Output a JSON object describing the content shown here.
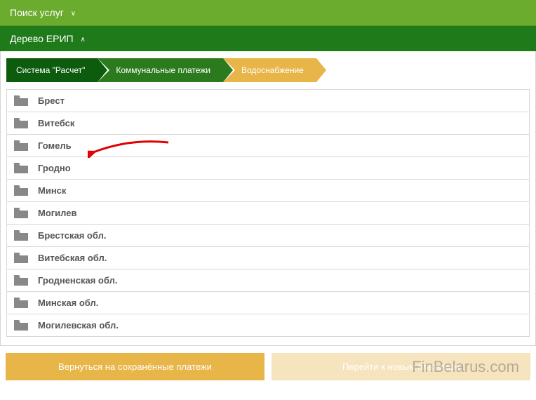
{
  "header": {
    "search_label": "Поиск услуг",
    "tree_label": "Дерево ЕРИП"
  },
  "breadcrumb": {
    "items": [
      {
        "label": "Система \"Расчет\""
      },
      {
        "label": "Коммунальные платежи"
      },
      {
        "label": "Водоснабжение"
      }
    ]
  },
  "folders": [
    {
      "label": "Брест"
    },
    {
      "label": "Витебск"
    },
    {
      "label": "Гомель"
    },
    {
      "label": "Гродно"
    },
    {
      "label": "Минск"
    },
    {
      "label": "Могилев"
    },
    {
      "label": "Брестская обл."
    },
    {
      "label": "Витебская обл."
    },
    {
      "label": "Гродненская обл."
    },
    {
      "label": "Минская обл."
    },
    {
      "label": "Могилевская обл."
    }
  ],
  "buttons": {
    "back_saved": "Вернуться на сохранённые платежи",
    "new_payments": "Перейти к новым платежам"
  },
  "watermark": "FinBelarus.com"
}
